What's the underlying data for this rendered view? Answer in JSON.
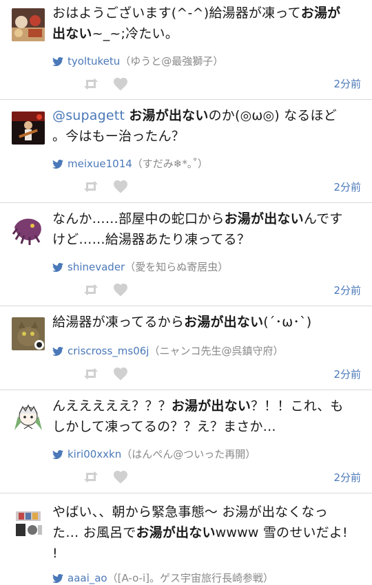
{
  "tweets": [
    {
      "id": "t1",
      "text_lines": [
        {
          "segments": [
            {
              "t": "おはようございます(^-^)給湯器が凍って"
            },
            {
              "t": "お湯が",
              "b": true
            }
          ]
        },
        {
          "segments": [
            {
              "t": "出ない",
              "b": true
            },
            {
              "t": "~_~;冷たい。"
            }
          ]
        }
      ],
      "username": "tyoltuketu",
      "display_name": "（ゆうと@最強獅子）",
      "time": "2分前"
    },
    {
      "id": "t2",
      "text_lines": [
        {
          "segments": [
            {
              "t": "@supagett",
              "m": true
            },
            {
              "t": " "
            },
            {
              "t": "お湯が出ない",
              "b": true
            },
            {
              "t": "のか(◎ω◎) なるほど"
            }
          ]
        },
        {
          "segments": [
            {
              "t": "。今はもー治ったん？"
            }
          ]
        }
      ],
      "username": "meixue1014",
      "display_name": "（すだみ❄*｡˚）",
      "time": "2分前"
    },
    {
      "id": "t3",
      "text_lines": [
        {
          "segments": [
            {
              "t": "なんか……部屋中の蛇口から"
            },
            {
              "t": "お湯が出ない",
              "b": true
            },
            {
              "t": "んです"
            }
          ]
        },
        {
          "segments": [
            {
              "t": "けど……給湯器あたり凍ってる？"
            }
          ]
        }
      ],
      "username": "shinevader",
      "display_name": "（愛を知らぬ寄居虫）",
      "time": "2分前"
    },
    {
      "id": "t4",
      "text_lines": [
        {
          "segments": [
            {
              "t": "給湯器が凍ってるから"
            },
            {
              "t": "お湯が出ない",
              "b": true
            },
            {
              "t": "(´･ω･`)"
            }
          ]
        }
      ],
      "username": "criscross_ms06j",
      "display_name": "（ニャンコ先生@呉鎮守府）",
      "time": "2分前"
    },
    {
      "id": "t5",
      "text_lines": [
        {
          "segments": [
            {
              "t": "んえええええ？？？"
            },
            {
              "t": "お湯が出ない",
              "b": true
            },
            {
              "t": "？！！これ、も"
            }
          ]
        },
        {
          "segments": [
            {
              "t": "しかして凍ってるの？？え？まさか…"
            }
          ]
        }
      ],
      "username": "kiri00xxkn",
      "display_name": "（はんぺん@ついった再開）",
      "time": "2分前"
    },
    {
      "id": "t6",
      "text_lines": [
        {
          "segments": [
            {
              "t": "やばい、、朝から緊急事態〜 お湯が出なくなっ"
            }
          ]
        },
        {
          "segments": [
            {
              "t": "た… お風呂で"
            },
            {
              "t": "お湯が出ない",
              "b": true
            },
            {
              "t": "wwww 雪のせいだよ!"
            }
          ]
        },
        {
          "segments": [
            {
              "t": "!"
            }
          ]
        }
      ],
      "username": "aaai_ao",
      "display_name": "（[A-o-i]。ゲス宇宙旅行長崎参戦）",
      "time": ""
    }
  ],
  "colors": {
    "link": "#4a78b8",
    "muted": "#888888",
    "icon": "#d0d0d0",
    "divider": "#d9d9d9"
  },
  "icons": {
    "bird": "twitter-bird-icon",
    "retweet": "retweet-icon",
    "favorite": "favorite-heart-icon"
  }
}
